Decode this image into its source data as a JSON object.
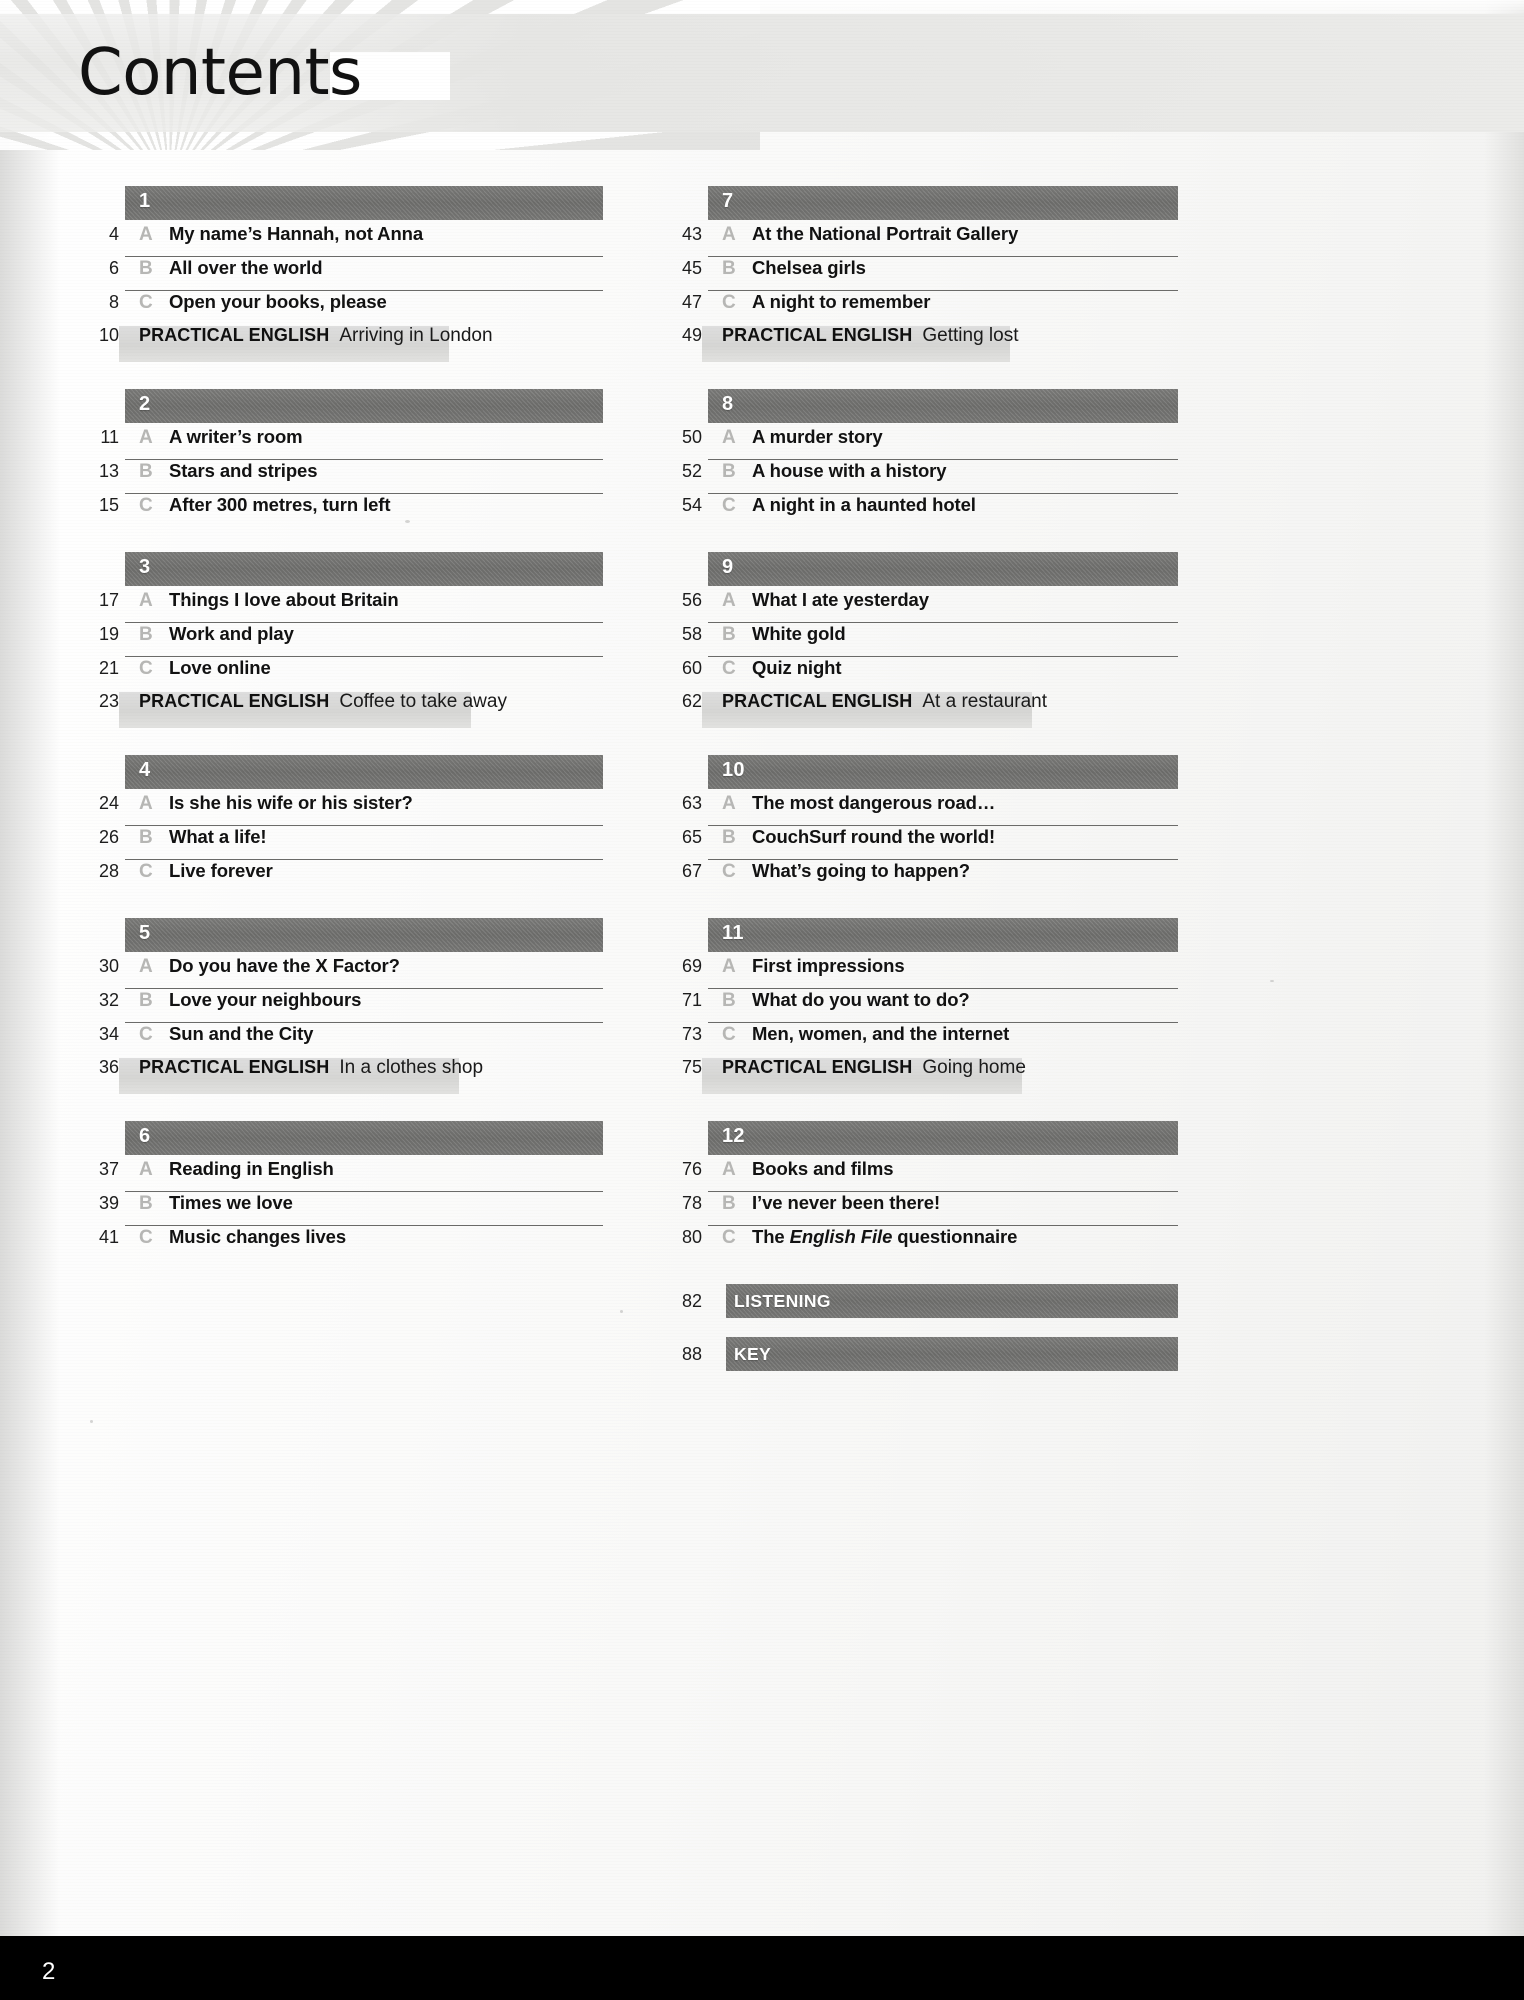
{
  "header": {
    "title": "Contents"
  },
  "labels": {
    "practical_english": "PRACTICAL ENGLISH"
  },
  "footer": {
    "page_number": "2"
  },
  "left_column": [
    {
      "unit": "1",
      "rows": [
        {
          "page": "4",
          "letter": "A",
          "title": "My name’s Hannah, not Anna"
        },
        {
          "page": "6",
          "letter": "B",
          "title": "All over the world"
        },
        {
          "page": "8",
          "letter": "C",
          "title": "Open your books, please"
        }
      ],
      "practical": {
        "page": "10",
        "label": "PRACTICAL ENGLISH",
        "title": "Arriving in London",
        "band_width": 330
      }
    },
    {
      "unit": "2",
      "rows": [
        {
          "page": "11",
          "letter": "A",
          "title": "A writer’s room"
        },
        {
          "page": "13",
          "letter": "B",
          "title": "Stars and stripes"
        },
        {
          "page": "15",
          "letter": "C",
          "title": "After 300 metres, turn left"
        }
      ],
      "practical": null
    },
    {
      "unit": "3",
      "rows": [
        {
          "page": "17",
          "letter": "A",
          "title": "Things I love about Britain"
        },
        {
          "page": "19",
          "letter": "B",
          "title": "Work and play"
        },
        {
          "page": "21",
          "letter": "C",
          "title": "Love online"
        }
      ],
      "practical": {
        "page": "23",
        "label": "PRACTICAL ENGLISH",
        "title": "Coffee to take away",
        "band_width": 352
      }
    },
    {
      "unit": "4",
      "rows": [
        {
          "page": "24",
          "letter": "A",
          "title": "Is she his wife or his sister?"
        },
        {
          "page": "26",
          "letter": "B",
          "title": "What a life!"
        },
        {
          "page": "28",
          "letter": "C",
          "title": "Live forever"
        }
      ],
      "practical": null
    },
    {
      "unit": "5",
      "rows": [
        {
          "page": "30",
          "letter": "A",
          "title": "Do you have the X Factor?"
        },
        {
          "page": "32",
          "letter": "B",
          "title": "Love your neighbours"
        },
        {
          "page": "34",
          "letter": "C",
          "title": "Sun and the City"
        }
      ],
      "practical": {
        "page": "36",
        "label": "PRACTICAL ENGLISH",
        "title": "In a clothes shop",
        "band_width": 340
      }
    },
    {
      "unit": "6",
      "rows": [
        {
          "page": "37",
          "letter": "A",
          "title": "Reading in English"
        },
        {
          "page": "39",
          "letter": "B",
          "title": "Times we love"
        },
        {
          "page": "41",
          "letter": "C",
          "title": "Music changes lives"
        }
      ],
      "practical": null
    }
  ],
  "right_column": [
    {
      "unit": "7",
      "rows": [
        {
          "page": "43",
          "letter": "A",
          "title": "At the National Portrait Gallery"
        },
        {
          "page": "45",
          "letter": "B",
          "title": "Chelsea girls"
        },
        {
          "page": "47",
          "letter": "C",
          "title": "A night to remember"
        }
      ],
      "practical": {
        "page": "49",
        "label": "PRACTICAL ENGLISH",
        "title": "Getting lost",
        "band_width": 308
      }
    },
    {
      "unit": "8",
      "rows": [
        {
          "page": "50",
          "letter": "A",
          "title": "A murder story"
        },
        {
          "page": "52",
          "letter": "B",
          "title": "A house with a history"
        },
        {
          "page": "54",
          "letter": "C",
          "title": "A night in a haunted hotel"
        }
      ],
      "practical": null
    },
    {
      "unit": "9",
      "rows": [
        {
          "page": "56",
          "letter": "A",
          "title": "What I ate yesterday"
        },
        {
          "page": "58",
          "letter": "B",
          "title": "White gold"
        },
        {
          "page": "60",
          "letter": "C",
          "title": "Quiz night"
        }
      ],
      "practical": {
        "page": "62",
        "label": "PRACTICAL ENGLISH",
        "title": "At a restaurant",
        "band_width": 330
      }
    },
    {
      "unit": "10",
      "rows": [
        {
          "page": "63",
          "letter": "A",
          "title": "The most dangerous road…"
        },
        {
          "page": "65",
          "letter": "B",
          "title": "CouchSurf round the world!"
        },
        {
          "page": "67",
          "letter": "C",
          "title": "What’s going to happen?"
        }
      ],
      "practical": null
    },
    {
      "unit": "11",
      "rows": [
        {
          "page": "69",
          "letter": "A",
          "title": "First impressions"
        },
        {
          "page": "71",
          "letter": "B",
          "title": "What do you want to do?"
        },
        {
          "page": "73",
          "letter": "C",
          "title": "Men, women, and the internet"
        }
      ],
      "practical": {
        "page": "75",
        "label": "PRACTICAL ENGLISH",
        "title": "Going home",
        "band_width": 320
      }
    },
    {
      "unit": "12",
      "rows": [
        {
          "page": "76",
          "letter": "A",
          "title": "Books and films"
        },
        {
          "page": "78",
          "letter": "B",
          "title": "I’ve never been there!"
        },
        {
          "page": "80",
          "letter": "C",
          "title": "The English File questionnaire",
          "italic": "English File"
        }
      ],
      "practical": null
    }
  ],
  "back_sections": [
    {
      "page": "82",
      "label": "LISTENING"
    },
    {
      "page": "88",
      "label": "KEY"
    }
  ]
}
